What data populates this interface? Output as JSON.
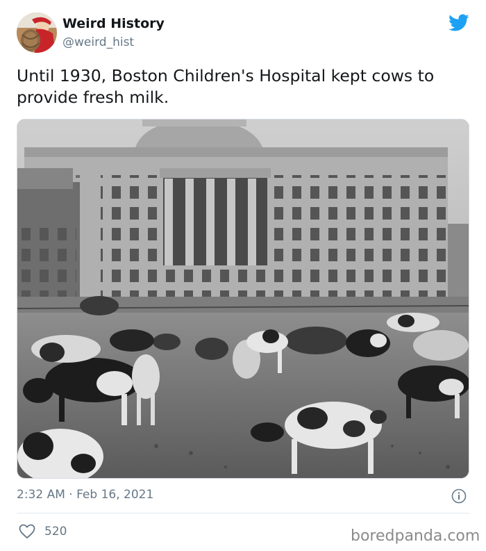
{
  "author": {
    "display_name": "Weird History",
    "handle": "@weird_hist",
    "avatar_icon": "avatar-image"
  },
  "brand_icon": "twitter-bird-icon",
  "tweet": {
    "text": "Until 1930, Boston Children's Hospital kept cows to provide fresh milk."
  },
  "media": {
    "icon": "historical-photo"
  },
  "meta": {
    "timestamp": "2:32 AM · Feb 16, 2021",
    "info_icon": "info-icon"
  },
  "engagement": {
    "likes": "520",
    "like_icon": "heart-icon"
  },
  "watermark": "boredpanda.com",
  "colors": {
    "twitter_blue": "#1da1f2",
    "text": "#14171a",
    "muted": "#657786"
  }
}
